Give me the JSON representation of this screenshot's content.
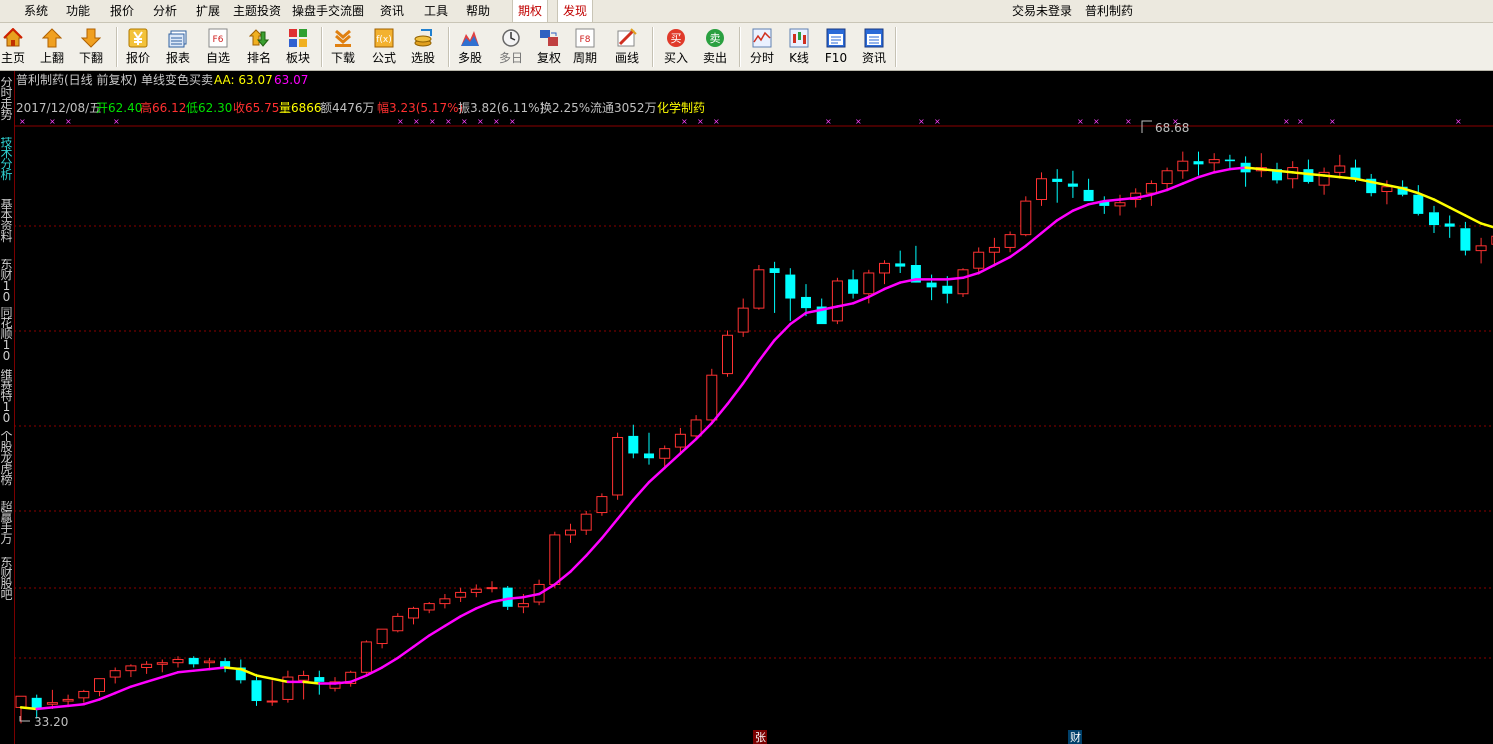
{
  "menubar": {
    "items": [
      "系统",
      "功能",
      "报价",
      "分析",
      "扩展",
      "主题投资",
      "操盘手交流圈",
      "资讯",
      "工具",
      "帮助"
    ],
    "highlight": [
      "期权",
      "发现"
    ],
    "login_status": "交易未登录",
    "stock_name": "普利制药"
  },
  "toolbar": {
    "buttons": [
      {
        "label": "主页",
        "icon": "home-icon"
      },
      {
        "label": "上翻",
        "icon": "arrow-up-icon"
      },
      {
        "label": "下翻",
        "icon": "arrow-down-icon"
      },
      {
        "label": "报价",
        "icon": "yen-icon"
      },
      {
        "label": "报表",
        "icon": "report-icon"
      },
      {
        "label": "自选",
        "icon": "f6-icon"
      },
      {
        "label": "排名",
        "icon": "ranking-icon"
      },
      {
        "label": "板块",
        "icon": "sector-icon"
      },
      {
        "label": "下载",
        "icon": "download-icon"
      },
      {
        "label": "公式",
        "icon": "formula-icon"
      },
      {
        "label": "选股",
        "icon": "stock-pick-icon"
      },
      {
        "label": "多股",
        "icon": "multi-stock-icon"
      },
      {
        "label": "多日",
        "icon": "clock-icon"
      },
      {
        "label": "复权",
        "icon": "adjust-icon"
      },
      {
        "label": "周期",
        "icon": "f8-icon"
      },
      {
        "label": "画线",
        "icon": "draw-line-icon"
      },
      {
        "label": "买入",
        "icon": "buy-icon"
      },
      {
        "label": "卖出",
        "icon": "sell-icon"
      },
      {
        "label": "分时",
        "icon": "intraday-icon"
      },
      {
        "label": "K线",
        "icon": "kline-icon"
      },
      {
        "label": "F10",
        "icon": "f10-icon"
      },
      {
        "label": "资讯",
        "icon": "news-icon"
      }
    ],
    "f6_text": "F6",
    "f8_text": "F8",
    "buy_glyph": "买",
    "sell_glyph": "卖"
  },
  "side_tabs": [
    {
      "label": "分时走势",
      "active": false
    },
    {
      "label": "技术分析",
      "active": true
    },
    {
      "label": "基本资料",
      "active": false
    },
    {
      "label": "东财10",
      "active": false
    },
    {
      "label": "同花顺10",
      "active": false
    },
    {
      "label": "维赛特10",
      "active": false
    },
    {
      "label": "个股龙虎榜",
      "active": false
    },
    {
      "label": "超赢手万",
      "active": false
    },
    {
      "label": "东财股吧",
      "active": false
    }
  ],
  "chart_header": {
    "title": "普利制药(日线 前复权) 单线变色买卖",
    "aa_label": "AA: 63.07",
    "aa_value2": "63.07",
    "date": "2017/12/08/五",
    "open": "开62.40",
    "high": "高66.12",
    "low": "低62.30",
    "close": "收65.75",
    "volume": "量6866",
    "amount": "额4476万",
    "change": "幅3.23(5.17%)",
    "amplitude": "振3.82(6.11%)",
    "turnover": "换2.25%",
    "float": "流通3052万",
    "industry": "化学制药"
  },
  "chart_data": {
    "type": "candlestick",
    "high_label": "68.68",
    "low_label": "33.20",
    "bottom_markers": [
      "张",
      "财"
    ],
    "ylim": [
      33.2,
      68.7
    ],
    "ohlc": [
      [
        33.8,
        34.5,
        32.8,
        34.5
      ],
      [
        34.4,
        34.6,
        33.1,
        33.7
      ],
      [
        34.0,
        34.9,
        33.7,
        34.1
      ],
      [
        34.2,
        34.6,
        33.9,
        34.3
      ],
      [
        34.4,
        34.9,
        34.1,
        34.8
      ],
      [
        34.8,
        35.6,
        34.5,
        35.6
      ],
      [
        35.7,
        36.3,
        35.3,
        36.1
      ],
      [
        36.1,
        36.5,
        35.7,
        36.4
      ],
      [
        36.3,
        36.7,
        35.9,
        36.5
      ],
      [
        36.5,
        36.8,
        36.0,
        36.6
      ],
      [
        36.6,
        37.0,
        36.3,
        36.8
      ],
      [
        36.9,
        37.0,
        36.3,
        36.5
      ],
      [
        36.6,
        36.9,
        36.2,
        36.7
      ],
      [
        36.7,
        36.9,
        36.0,
        36.3
      ],
      [
        36.3,
        36.8,
        35.3,
        35.5
      ],
      [
        35.5,
        35.9,
        33.9,
        34.2
      ],
      [
        34.2,
        35.5,
        33.9,
        34.2
      ],
      [
        34.3,
        36.1,
        34.1,
        35.7
      ],
      [
        35.5,
        36.1,
        34.3,
        35.8
      ],
      [
        35.7,
        36.1,
        34.6,
        35.4
      ],
      [
        35.0,
        35.7,
        34.8,
        35.4
      ],
      [
        35.3,
        36.1,
        35.1,
        36.0
      ],
      [
        36.0,
        38.0,
        35.9,
        37.9
      ],
      [
        37.8,
        38.7,
        37.5,
        38.7
      ],
      [
        38.6,
        39.7,
        38.5,
        39.5
      ],
      [
        39.4,
        40.1,
        39.0,
        40.0
      ],
      [
        39.9,
        40.4,
        39.7,
        40.3
      ],
      [
        40.3,
        40.9,
        40.0,
        40.6
      ],
      [
        40.7,
        41.3,
        40.4,
        41.0
      ],
      [
        41.0,
        41.5,
        40.7,
        41.2
      ],
      [
        41.3,
        41.7,
        41.0,
        41.3
      ],
      [
        41.3,
        41.4,
        39.9,
        40.1
      ],
      [
        40.1,
        40.9,
        39.7,
        40.3
      ],
      [
        40.4,
        41.8,
        40.2,
        41.5
      ],
      [
        41.5,
        44.8,
        41.3,
        44.6
      ],
      [
        44.6,
        45.3,
        44.1,
        44.9
      ],
      [
        44.9,
        46.1,
        44.6,
        45.9
      ],
      [
        46.0,
        47.2,
        45.8,
        47.0
      ],
      [
        47.1,
        51.0,
        46.8,
        50.7
      ],
      [
        50.8,
        51.5,
        49.4,
        49.7
      ],
      [
        49.7,
        51.0,
        49.0,
        49.4
      ],
      [
        49.4,
        50.2,
        48.7,
        50.0
      ],
      [
        50.1,
        51.3,
        49.6,
        50.9
      ],
      [
        50.8,
        52.1,
        50.6,
        51.8
      ],
      [
        51.8,
        55.0,
        51.6,
        54.6
      ],
      [
        54.7,
        57.4,
        54.5,
        57.1
      ],
      [
        57.3,
        59.4,
        57.0,
        58.8
      ],
      [
        58.8,
        61.5,
        58.7,
        61.2
      ],
      [
        61.3,
        61.7,
        58.5,
        61.0
      ],
      [
        60.9,
        61.3,
        58.0,
        59.4
      ],
      [
        59.5,
        60.3,
        58.3,
        58.8
      ],
      [
        58.9,
        59.4,
        57.8,
        57.8
      ],
      [
        58.0,
        60.7,
        57.8,
        60.5
      ],
      [
        60.6,
        61.2,
        59.4,
        59.7
      ],
      [
        59.7,
        61.2,
        59.1,
        61.0
      ],
      [
        61.0,
        61.8,
        60.3,
        61.6
      ],
      [
        61.6,
        62.4,
        61.0,
        61.4
      ],
      [
        61.5,
        62.7,
        60.8,
        60.4
      ],
      [
        60.4,
        60.9,
        59.3,
        60.1
      ],
      [
        60.2,
        60.8,
        59.1,
        59.7
      ],
      [
        59.7,
        61.3,
        59.5,
        61.2
      ],
      [
        61.3,
        62.6,
        60.9,
        62.3
      ],
      [
        62.3,
        63.2,
        61.4,
        62.6
      ],
      [
        62.6,
        63.6,
        62.3,
        63.4
      ],
      [
        63.4,
        65.8,
        63.3,
        65.5
      ],
      [
        65.6,
        67.3,
        65.2,
        66.9
      ],
      [
        66.9,
        67.5,
        65.4,
        66.7
      ],
      [
        66.6,
        67.4,
        65.7,
        66.4
      ],
      [
        66.2,
        66.9,
        65.5,
        65.5
      ],
      [
        65.5,
        65.8,
        64.7,
        65.2
      ],
      [
        65.2,
        65.9,
        64.6,
        65.4
      ],
      [
        65.6,
        66.3,
        65.1,
        66.0
      ],
      [
        66.0,
        66.8,
        65.2,
        66.6
      ],
      [
        66.6,
        67.6,
        66.2,
        67.4
      ],
      [
        67.4,
        68.6,
        66.9,
        68.0
      ],
      [
        68.0,
        68.6,
        67.1,
        67.8
      ],
      [
        67.9,
        68.5,
        67.3,
        68.1
      ],
      [
        68.1,
        68.4,
        67.5,
        68.0
      ],
      [
        67.9,
        68.3,
        66.4,
        67.3
      ],
      [
        67.4,
        68.5,
        67.0,
        67.6
      ],
      [
        67.5,
        67.9,
        66.6,
        66.8
      ],
      [
        66.9,
        68.0,
        66.3,
        67.6
      ],
      [
        67.5,
        68.1,
        66.6,
        66.7
      ],
      [
        66.5,
        67.6,
        65.9,
        67.3
      ],
      [
        67.3,
        68.4,
        67.0,
        67.7
      ],
      [
        67.6,
        68.1,
        66.7,
        66.9
      ],
      [
        66.9,
        67.2,
        65.8,
        66.0
      ],
      [
        66.1,
        66.8,
        65.3,
        66.4
      ],
      [
        66.4,
        66.8,
        65.8,
        65.9
      ],
      [
        65.9,
        66.5,
        64.6,
        64.7
      ],
      [
        64.8,
        65.2,
        63.5,
        64.0
      ],
      [
        64.1,
        64.6,
        63.2,
        63.9
      ],
      [
        63.8,
        64.2,
        62.1,
        62.4
      ],
      [
        62.4,
        63.2,
        61.6,
        62.7
      ],
      [
        62.8,
        63.5,
        62.5,
        63.3
      ],
      [
        63.2,
        64.3,
        62.8,
        63.0
      ],
      [
        62.9,
        63.6,
        61.9,
        62.2
      ],
      [
        62.2,
        62.6,
        61.2,
        61.3
      ],
      [
        61.4,
        62.2,
        61.0,
        61.6
      ],
      [
        61.7,
        62.8,
        61.6,
        62.5
      ],
      [
        62.4,
        63.2,
        62.0,
        62.4
      ],
      [
        62.4,
        64.0,
        62.3,
        63.1
      ],
      [
        62.4,
        66.1,
        62.3,
        65.75
      ]
    ],
    "ma": [
      33.8,
      33.7,
      33.8,
      33.9,
      34.0,
      34.3,
      34.7,
      35.1,
      35.4,
      35.7,
      36.0,
      36.1,
      36.2,
      36.3,
      36.2,
      35.8,
      35.6,
      35.4,
      35.4,
      35.3,
      35.3,
      35.4,
      35.8,
      36.3,
      36.9,
      37.6,
      38.3,
      38.9,
      39.5,
      40.0,
      40.4,
      40.6,
      40.7,
      40.9,
      41.5,
      42.3,
      43.3,
      44.4,
      45.6,
      46.8,
      47.9,
      48.8,
      49.7,
      50.6,
      51.6,
      52.8,
      54.1,
      55.5,
      56.8,
      57.8,
      58.5,
      58.7,
      58.9,
      59.1,
      59.5,
      60.0,
      60.4,
      60.6,
      60.6,
      60.6,
      60.7,
      61.0,
      61.5,
      62.0,
      62.7,
      63.5,
      64.3,
      64.9,
      65.3,
      65.5,
      65.6,
      65.7,
      65.9,
      66.2,
      66.6,
      67.0,
      67.3,
      67.5,
      67.6,
      67.5,
      67.4,
      67.3,
      67.2,
      67.1,
      67.0,
      66.9,
      66.7,
      66.5,
      66.3,
      66.0,
      65.6,
      65.1,
      64.6,
      64.1,
      63.8,
      63.5,
      63.2,
      63.0,
      62.8,
      62.6,
      62.5,
      62.6,
      63.07
    ],
    "ma_color_rule": "magenta when rising, yellow when falling"
  },
  "colors": {
    "up_candle": "#ff3232",
    "down_candle": "#00ffff",
    "ma_up": "#ff00ff",
    "ma_down": "#ffff00",
    "grid": "#8b0000",
    "label_gray": "#c0c0c0",
    "value_green": "#00e000",
    "value_red": "#ff3030",
    "value_yellow": "#ffff00",
    "value_magenta": "#ff00ff"
  }
}
